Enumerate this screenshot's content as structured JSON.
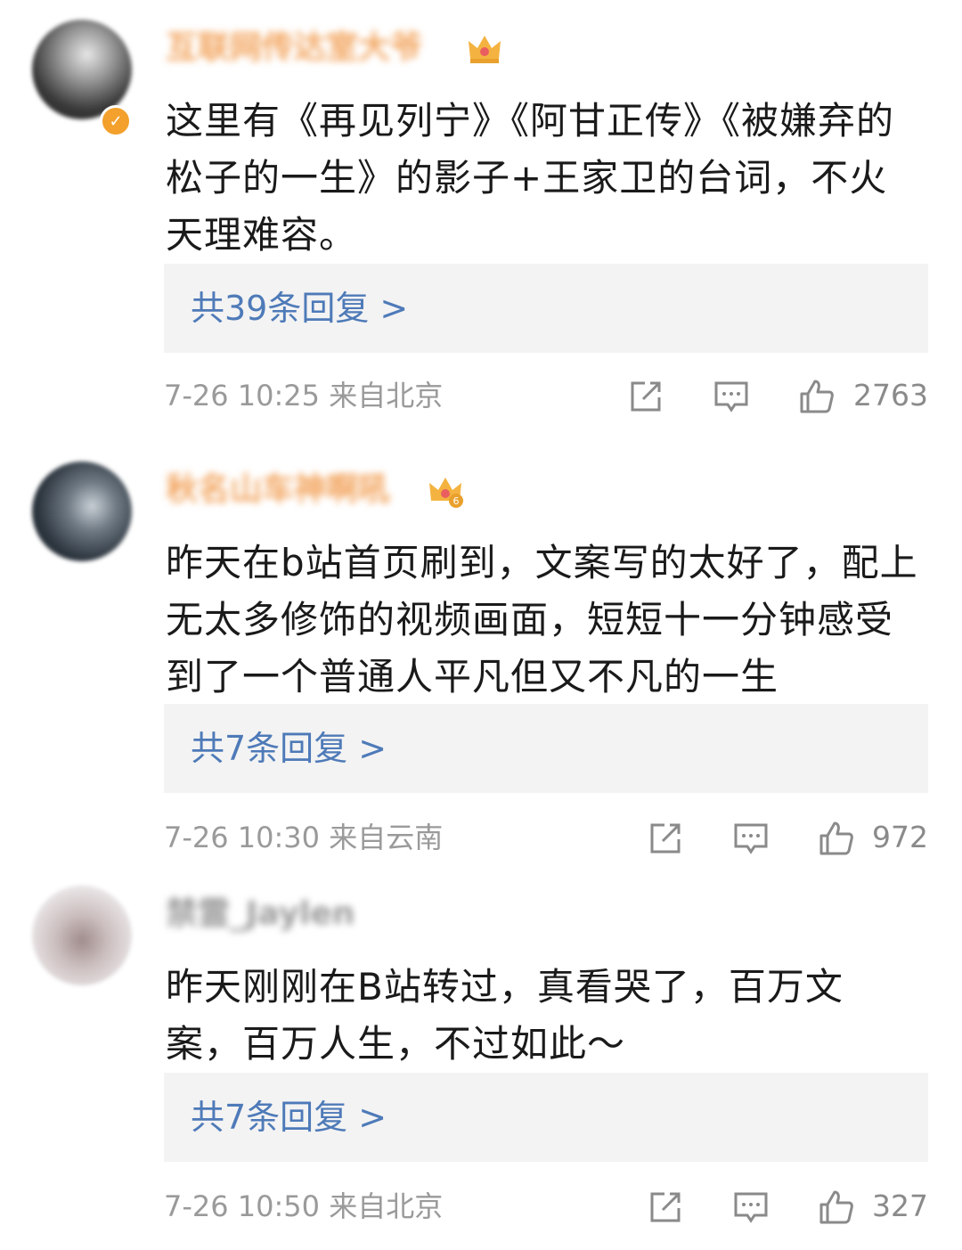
{
  "comments": [
    {
      "username": "互联网传达室大爷",
      "text": "这里有《再见列宁》《阿甘正传》《被嫌弃的松子的一生》的影子+王家卫的台词，不火天理难容。",
      "replies": "共39条回复 >",
      "time": "7-26 10:25 来自北京",
      "likes": "2763"
    },
    {
      "username": "秋名山车神啊吼",
      "text": "昨天在b站首页刷到，文案写的太好了，配上无太多修饰的视频画面，短短十一分钟感受到了一个普通人平凡但又不凡的一生",
      "replies": "共7条回复 >",
      "time": "7-26 10:30 来自云南",
      "likes": "972"
    },
    {
      "username": "禁霊_Jaylen",
      "text": "昨天刚刚在B站转过，真看哭了，百万文案，百万人生，不过如此～",
      "replies": "共7条回复 >",
      "time": "7-26 10:50 来自北京",
      "likes": "327"
    }
  ],
  "icons": [
    "crown-icon",
    "verified-badge-icon",
    "share-icon",
    "comment-icon",
    "thumbs-up-icon"
  ],
  "colors": {
    "link": "#4e7ab8",
    "meta": "#9a9a9a",
    "reply_bg": "#f3f3f3",
    "badge": "#f3a12c"
  }
}
